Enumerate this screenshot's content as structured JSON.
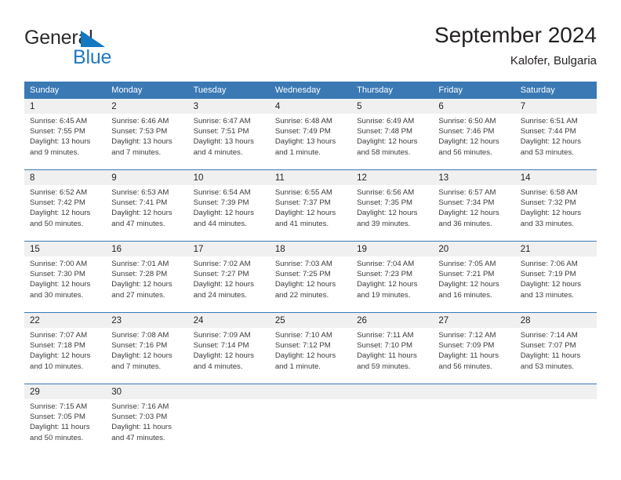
{
  "brand": {
    "name_part1": "General",
    "name_part2": "Blue",
    "accent_color": "#1f7ac4",
    "triangle_color": "#1378c0"
  },
  "header": {
    "month_title": "September 2024",
    "location": "Kalofer, Bulgaria"
  },
  "theme": {
    "header_blue": "#3a79b4",
    "daynum_band": "#f0f0f0",
    "text": "#231f20"
  },
  "weekdays": [
    "Sunday",
    "Monday",
    "Tuesday",
    "Wednesday",
    "Thursday",
    "Friday",
    "Saturday"
  ],
  "weeks": [
    {
      "days": [
        {
          "num": "1",
          "sunrise": "Sunrise: 6:45 AM",
          "sunset": "Sunset: 7:55 PM",
          "daylight1": "Daylight: 13 hours",
          "daylight2": "and 9 minutes."
        },
        {
          "num": "2",
          "sunrise": "Sunrise: 6:46 AM",
          "sunset": "Sunset: 7:53 PM",
          "daylight1": "Daylight: 13 hours",
          "daylight2": "and 7 minutes."
        },
        {
          "num": "3",
          "sunrise": "Sunrise: 6:47 AM",
          "sunset": "Sunset: 7:51 PM",
          "daylight1": "Daylight: 13 hours",
          "daylight2": "and 4 minutes."
        },
        {
          "num": "4",
          "sunrise": "Sunrise: 6:48 AM",
          "sunset": "Sunset: 7:49 PM",
          "daylight1": "Daylight: 13 hours",
          "daylight2": "and 1 minute."
        },
        {
          "num": "5",
          "sunrise": "Sunrise: 6:49 AM",
          "sunset": "Sunset: 7:48 PM",
          "daylight1": "Daylight: 12 hours",
          "daylight2": "and 58 minutes."
        },
        {
          "num": "6",
          "sunrise": "Sunrise: 6:50 AM",
          "sunset": "Sunset: 7:46 PM",
          "daylight1": "Daylight: 12 hours",
          "daylight2": "and 56 minutes."
        },
        {
          "num": "7",
          "sunrise": "Sunrise: 6:51 AM",
          "sunset": "Sunset: 7:44 PM",
          "daylight1": "Daylight: 12 hours",
          "daylight2": "and 53 minutes."
        }
      ]
    },
    {
      "days": [
        {
          "num": "8",
          "sunrise": "Sunrise: 6:52 AM",
          "sunset": "Sunset: 7:42 PM",
          "daylight1": "Daylight: 12 hours",
          "daylight2": "and 50 minutes."
        },
        {
          "num": "9",
          "sunrise": "Sunrise: 6:53 AM",
          "sunset": "Sunset: 7:41 PM",
          "daylight1": "Daylight: 12 hours",
          "daylight2": "and 47 minutes."
        },
        {
          "num": "10",
          "sunrise": "Sunrise: 6:54 AM",
          "sunset": "Sunset: 7:39 PM",
          "daylight1": "Daylight: 12 hours",
          "daylight2": "and 44 minutes."
        },
        {
          "num": "11",
          "sunrise": "Sunrise: 6:55 AM",
          "sunset": "Sunset: 7:37 PM",
          "daylight1": "Daylight: 12 hours",
          "daylight2": "and 41 minutes."
        },
        {
          "num": "12",
          "sunrise": "Sunrise: 6:56 AM",
          "sunset": "Sunset: 7:35 PM",
          "daylight1": "Daylight: 12 hours",
          "daylight2": "and 39 minutes."
        },
        {
          "num": "13",
          "sunrise": "Sunrise: 6:57 AM",
          "sunset": "Sunset: 7:34 PM",
          "daylight1": "Daylight: 12 hours",
          "daylight2": "and 36 minutes."
        },
        {
          "num": "14",
          "sunrise": "Sunrise: 6:58 AM",
          "sunset": "Sunset: 7:32 PM",
          "daylight1": "Daylight: 12 hours",
          "daylight2": "and 33 minutes."
        }
      ]
    },
    {
      "days": [
        {
          "num": "15",
          "sunrise": "Sunrise: 7:00 AM",
          "sunset": "Sunset: 7:30 PM",
          "daylight1": "Daylight: 12 hours",
          "daylight2": "and 30 minutes."
        },
        {
          "num": "16",
          "sunrise": "Sunrise: 7:01 AM",
          "sunset": "Sunset: 7:28 PM",
          "daylight1": "Daylight: 12 hours",
          "daylight2": "and 27 minutes."
        },
        {
          "num": "17",
          "sunrise": "Sunrise: 7:02 AM",
          "sunset": "Sunset: 7:27 PM",
          "daylight1": "Daylight: 12 hours",
          "daylight2": "and 24 minutes."
        },
        {
          "num": "18",
          "sunrise": "Sunrise: 7:03 AM",
          "sunset": "Sunset: 7:25 PM",
          "daylight1": "Daylight: 12 hours",
          "daylight2": "and 22 minutes."
        },
        {
          "num": "19",
          "sunrise": "Sunrise: 7:04 AM",
          "sunset": "Sunset: 7:23 PM",
          "daylight1": "Daylight: 12 hours",
          "daylight2": "and 19 minutes."
        },
        {
          "num": "20",
          "sunrise": "Sunrise: 7:05 AM",
          "sunset": "Sunset: 7:21 PM",
          "daylight1": "Daylight: 12 hours",
          "daylight2": "and 16 minutes."
        },
        {
          "num": "21",
          "sunrise": "Sunrise: 7:06 AM",
          "sunset": "Sunset: 7:19 PM",
          "daylight1": "Daylight: 12 hours",
          "daylight2": "and 13 minutes."
        }
      ]
    },
    {
      "days": [
        {
          "num": "22",
          "sunrise": "Sunrise: 7:07 AM",
          "sunset": "Sunset: 7:18 PM",
          "daylight1": "Daylight: 12 hours",
          "daylight2": "and 10 minutes."
        },
        {
          "num": "23",
          "sunrise": "Sunrise: 7:08 AM",
          "sunset": "Sunset: 7:16 PM",
          "daylight1": "Daylight: 12 hours",
          "daylight2": "and 7 minutes."
        },
        {
          "num": "24",
          "sunrise": "Sunrise: 7:09 AM",
          "sunset": "Sunset: 7:14 PM",
          "daylight1": "Daylight: 12 hours",
          "daylight2": "and 4 minutes."
        },
        {
          "num": "25",
          "sunrise": "Sunrise: 7:10 AM",
          "sunset": "Sunset: 7:12 PM",
          "daylight1": "Daylight: 12 hours",
          "daylight2": "and 1 minute."
        },
        {
          "num": "26",
          "sunrise": "Sunrise: 7:11 AM",
          "sunset": "Sunset: 7:10 PM",
          "daylight1": "Daylight: 11 hours",
          "daylight2": "and 59 minutes."
        },
        {
          "num": "27",
          "sunrise": "Sunrise: 7:12 AM",
          "sunset": "Sunset: 7:09 PM",
          "daylight1": "Daylight: 11 hours",
          "daylight2": "and 56 minutes."
        },
        {
          "num": "28",
          "sunrise": "Sunrise: 7:14 AM",
          "sunset": "Sunset: 7:07 PM",
          "daylight1": "Daylight: 11 hours",
          "daylight2": "and 53 minutes."
        }
      ]
    },
    {
      "days": [
        {
          "num": "29",
          "sunrise": "Sunrise: 7:15 AM",
          "sunset": "Sunset: 7:05 PM",
          "daylight1": "Daylight: 11 hours",
          "daylight2": "and 50 minutes."
        },
        {
          "num": "30",
          "sunrise": "Sunrise: 7:16 AM",
          "sunset": "Sunset: 7:03 PM",
          "daylight1": "Daylight: 11 hours",
          "daylight2": "and 47 minutes."
        },
        {
          "num": "",
          "sunrise": "",
          "sunset": "",
          "daylight1": "",
          "daylight2": ""
        },
        {
          "num": "",
          "sunrise": "",
          "sunset": "",
          "daylight1": "",
          "daylight2": ""
        },
        {
          "num": "",
          "sunrise": "",
          "sunset": "",
          "daylight1": "",
          "daylight2": ""
        },
        {
          "num": "",
          "sunrise": "",
          "sunset": "",
          "daylight1": "",
          "daylight2": ""
        },
        {
          "num": "",
          "sunrise": "",
          "sunset": "",
          "daylight1": "",
          "daylight2": ""
        }
      ]
    }
  ]
}
